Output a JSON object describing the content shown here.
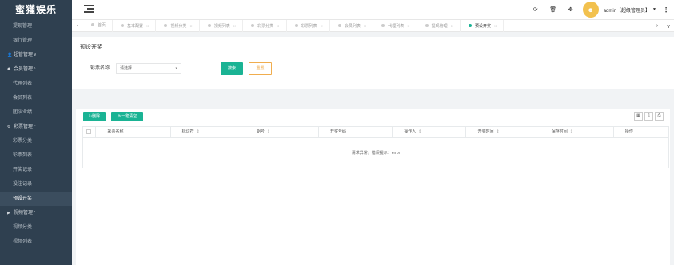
{
  "sidebar": {
    "logo": "蜜獾娱乐",
    "items": [
      {
        "type": "item",
        "label": "提现管理"
      },
      {
        "type": "item",
        "label": "银行管理"
      },
      {
        "type": "group",
        "icon": "person",
        "label": "超管管理",
        "arrow": "∨"
      },
      {
        "type": "group",
        "icon": "users",
        "label": "会员管理",
        "arrow": "^"
      },
      {
        "type": "item",
        "label": "代理列表"
      },
      {
        "type": "item",
        "label": "会员列表"
      },
      {
        "type": "item",
        "label": "团队业绩"
      },
      {
        "type": "group",
        "icon": "gear",
        "label": "彩票管理",
        "arrow": "^"
      },
      {
        "type": "item",
        "label": "彩票分类"
      },
      {
        "type": "item",
        "label": "彩票列表"
      },
      {
        "type": "item",
        "label": "开奖记录"
      },
      {
        "type": "item",
        "label": "投注记录"
      },
      {
        "type": "item",
        "label": "预设开奖",
        "active": true
      },
      {
        "type": "group",
        "icon": "video",
        "label": "视频管理",
        "arrow": "^"
      },
      {
        "type": "item",
        "label": "视频分类"
      },
      {
        "type": "item",
        "label": "视频列表"
      }
    ]
  },
  "header": {
    "user": "admin【超级管理员】",
    "avatar_color": "#f2c14e"
  },
  "tabs": [
    {
      "label": "首页",
      "closable": false
    },
    {
      "label": "基本配置",
      "closable": true
    },
    {
      "label": "视频分类",
      "closable": true
    },
    {
      "label": "视频列表",
      "closable": true
    },
    {
      "label": "彩票分类",
      "closable": true
    },
    {
      "label": "彩票列表",
      "closable": true
    },
    {
      "label": "会员列表",
      "closable": true
    },
    {
      "label": "代理列表",
      "closable": true
    },
    {
      "label": "提现管理",
      "closable": true
    },
    {
      "label": "预设开奖",
      "closable": true,
      "active": true
    }
  ],
  "filter": {
    "title": "预设开奖",
    "label": "彩票名称",
    "select_value": "请选择",
    "search_label": "搜索",
    "reset_label": "重置"
  },
  "table": {
    "delete_label": "删除",
    "onekey_label": "一键清空",
    "columns": [
      {
        "label": "彩票名称",
        "sortable": false,
        "width": 96
      },
      {
        "label": "标识符",
        "sortable": true,
        "width": 96
      },
      {
        "label": "期号",
        "sortable": true,
        "width": 95
      },
      {
        "label": "开奖号码",
        "sortable": false,
        "width": 95
      },
      {
        "label": "操作人",
        "sortable": true,
        "width": 95
      },
      {
        "label": "开奖时间",
        "sortable": true,
        "width": 95
      },
      {
        "label": "保存时间",
        "sortable": true,
        "width": 95
      },
      {
        "label": "操作",
        "sortable": false,
        "width": 70
      }
    ],
    "empty_message": "请求异常，错误提示：error"
  },
  "colors": {
    "sidebar_bg": "#2f4050",
    "primary": "#1ab394",
    "warning": "#f0ad4e"
  }
}
